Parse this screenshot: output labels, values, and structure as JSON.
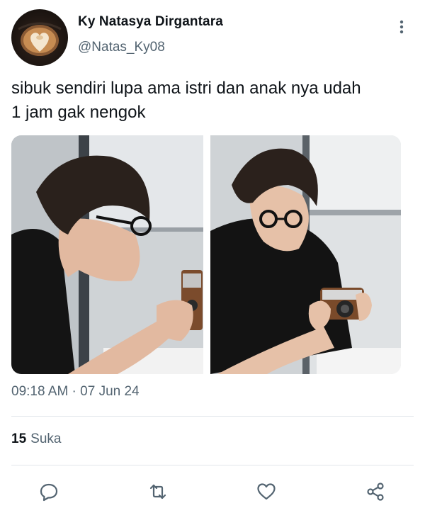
{
  "author": {
    "name": "Ky Natasya Dirgantara",
    "handle": "@Natas_Ky08",
    "avatar_icon": "latte-art-heart-avatar"
  },
  "menu": {
    "icon": "more-vertical-icon"
  },
  "tweet": {
    "text_line1": "sibuk sendiri lupa ama istri dan anak nya udah",
    "text_line2": "1 jam gak nengok"
  },
  "media": {
    "photos": [
      {
        "description_icon": "photo-man-glasses-camera-profile"
      },
      {
        "description_icon": "photo-man-glasses-camera-front"
      }
    ]
  },
  "meta": {
    "timestamp": "09:18 AM · 07 Jun 24"
  },
  "stats": {
    "likes_count": "15",
    "likes_label": "Suka"
  },
  "actions": {
    "reply_icon": "reply-icon",
    "retweet_icon": "retweet-icon",
    "like_icon": "heart-icon",
    "share_icon": "share-icon"
  },
  "colors": {
    "text_primary": "#0f1419",
    "text_secondary": "#536471",
    "divider": "#e1e6ea"
  }
}
